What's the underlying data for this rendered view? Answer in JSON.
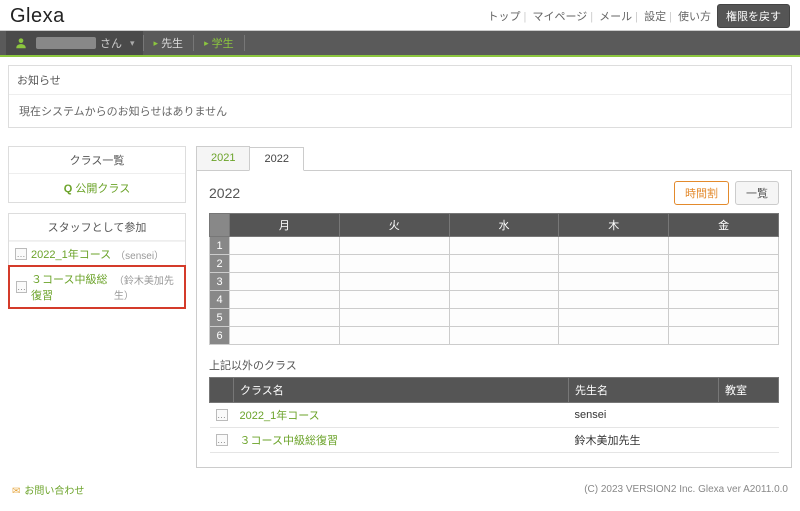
{
  "header": {
    "logo": "Glexa",
    "links": {
      "top": "トップ",
      "mypage": "マイページ",
      "mail": "メール",
      "settings": "設定",
      "howto": "使い方"
    },
    "return_priv_btn": "権限を戻す"
  },
  "navbar": {
    "user_suffix": "さん",
    "teacher": "先生",
    "student": "学生"
  },
  "notice": {
    "title": "お知らせ",
    "body": "現在システムからのお知らせはありません"
  },
  "sidebar": {
    "class_list_hdr": "クラス一覧",
    "public_class_label": "公開クラス",
    "staff_hdr": "スタッフとして参加",
    "items": [
      {
        "label": "2022_1年コース",
        "teacher": "（sensei）"
      },
      {
        "label": "３コース中級総復習",
        "teacher": "（鈴木美加先生）"
      }
    ]
  },
  "main": {
    "tabs": [
      {
        "label": "2021"
      },
      {
        "label": "2022"
      }
    ],
    "year_title": "2022",
    "btn_timetable": "時間割",
    "btn_list": "一覧",
    "days": {
      "mon": "月",
      "tue": "火",
      "wed": "水",
      "thu": "木",
      "fri": "金"
    },
    "periods": [
      "1",
      "2",
      "3",
      "4",
      "5",
      "6"
    ],
    "other_hdr": "上記以外のクラス",
    "other_cols": {
      "classname": "クラス名",
      "teacher": "先生名",
      "room": "教室"
    },
    "other_rows": [
      {
        "classname": "2022_1年コース",
        "teacher": "sensei",
        "room": ""
      },
      {
        "classname": "３コース中級総復習",
        "teacher": "鈴木美加先生",
        "room": ""
      }
    ]
  },
  "footer": {
    "contact": "お問い合わせ",
    "copyright": "(C) 2023 VERSION2 Inc.  Glexa ver A2011.0.0"
  }
}
